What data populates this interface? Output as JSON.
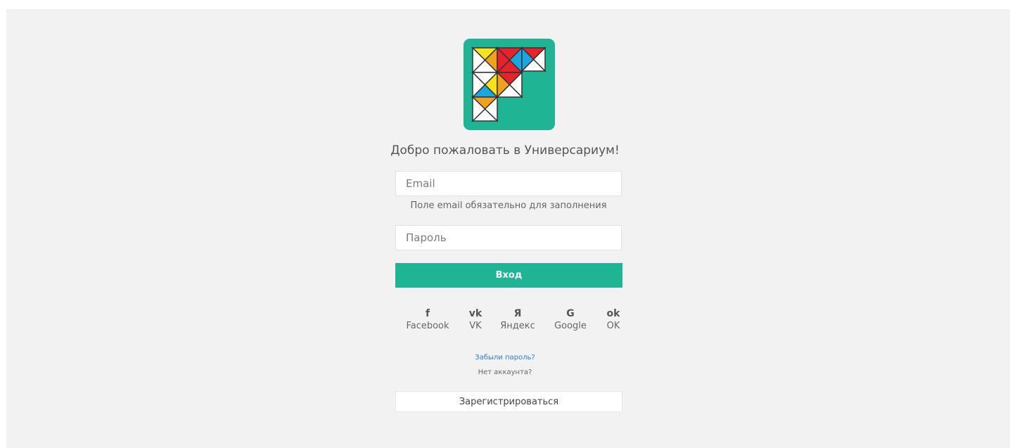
{
  "brand": {
    "accent": "#1eb494",
    "logo_name": "universarium-logo"
  },
  "welcome": "Добро пожаловать в Универсариум!",
  "email": {
    "placeholder": "Email",
    "value": ""
  },
  "email_error": "Поле email обязательно для заполнения",
  "password": {
    "placeholder": "Пароль",
    "value": ""
  },
  "login_label": "Вход",
  "social": [
    {
      "icon": "facebook-icon",
      "glyph": "f",
      "label": "Facebook"
    },
    {
      "icon": "vk-icon",
      "glyph": "vk",
      "label": "VK"
    },
    {
      "icon": "yandex-icon",
      "glyph": "Я",
      "label": "Яндекс"
    },
    {
      "icon": "google-icon",
      "glyph": "G",
      "label": "Google"
    },
    {
      "icon": "ok-icon",
      "glyph": "ok",
      "label": "OK"
    }
  ],
  "forgot": "Забыли пароль?",
  "no_account": "Нет аккаунта?",
  "register_label": "Зарегистрироваться"
}
